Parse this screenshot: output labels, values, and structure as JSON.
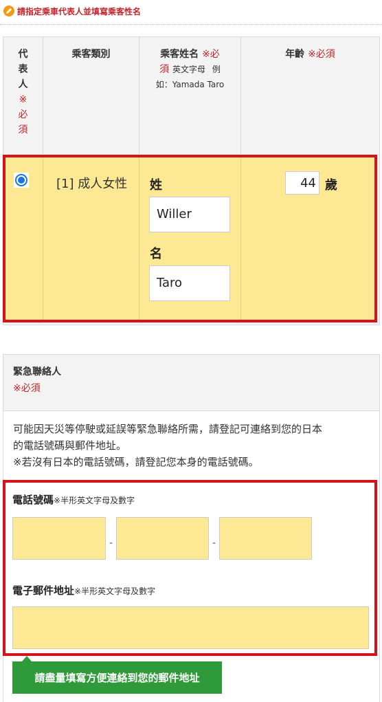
{
  "header": {
    "icon": "pencil-icon",
    "title": "請指定乘車代表人並填寫乘客性名"
  },
  "passenger_table": {
    "col_rep_label": [
      "代",
      "表",
      "人"
    ],
    "col_rep_req": [
      "※",
      "必",
      "須"
    ],
    "col_type_label": "乘客類別",
    "col_name_label": "乘客姓名",
    "col_name_req_1": "※必",
    "col_name_req_2": "須",
    "col_name_hint_1": "英文字母",
    "col_name_hint_2": "例",
    "col_name_hint_3": "如：Yamada Taro",
    "col_age_label": "年齡",
    "col_age_req": "※必須",
    "row": {
      "selected": true,
      "type": "[1] 成人女性",
      "last_name_label": "姓",
      "last_name_value": "Willer",
      "first_name_label": "名",
      "first_name_value": "Taro",
      "age_value": "44",
      "age_unit": "歲"
    }
  },
  "emergency": {
    "title": "緊急聯絡人",
    "required": "※必須",
    "desc_line1": "可能因天災等停駛或延誤等緊急聯絡所需，請登記可連絡到您的日本",
    "desc_line2": "的電話號碼與郵件地址。",
    "desc_line3": "※若沒有日本的電話號碼，請登記您本身的電話號碼。",
    "phone_label": "電話號碼",
    "phone_hint": "※半形英文字母及數字",
    "phone_sep": "-",
    "phone_values": [
      "",
      "",
      ""
    ],
    "email_label": "電子郵件地址",
    "email_hint": "※半形英文字母及數字",
    "email_value": "",
    "tooltip": "請盡量填寫方便連絡到您的郵件地址"
  },
  "colors": {
    "required_red": "#c0252b",
    "highlight_yellow": "#fde893",
    "frame_red": "#d8121d",
    "tooltip_green": "#2f9a3a",
    "radio_blue": "#1a73e8"
  }
}
